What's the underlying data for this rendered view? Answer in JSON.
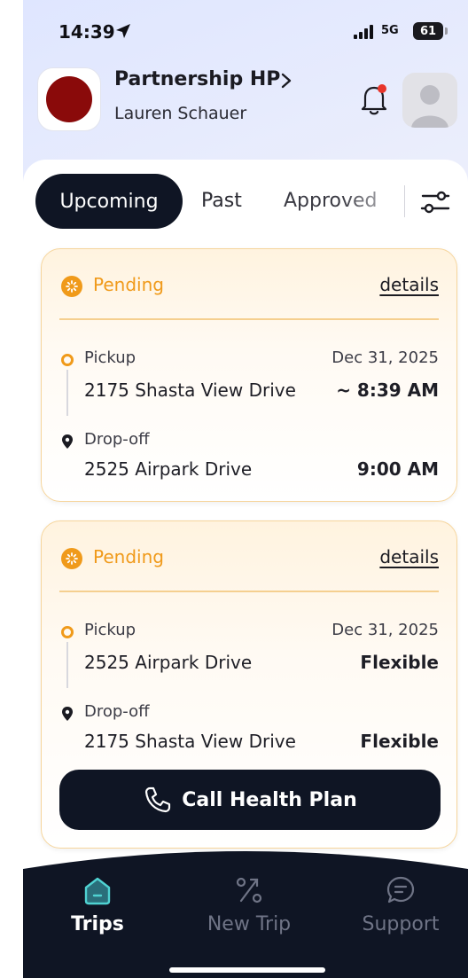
{
  "status_bar": {
    "time": "14:39",
    "network": "5G",
    "battery": "61"
  },
  "header": {
    "org_name": "Partnership HP",
    "user_name": "Lauren Schauer"
  },
  "tabs": {
    "upcoming": "Upcoming",
    "past": "Past",
    "approved": "Approved"
  },
  "trips": [
    {
      "status": "Pending",
      "details_label": "details",
      "pickup_label": "Pickup",
      "pickup_address": "2175 Shasta View Drive",
      "pickup_date": "Dec 31, 2025",
      "pickup_time": "~ 8:39 AM",
      "dropoff_label": "Drop-off",
      "dropoff_address": "2525 Airpark Drive",
      "dropoff_time": "9:00 AM"
    },
    {
      "status": "Pending",
      "details_label": "details",
      "pickup_label": "Pickup",
      "pickup_address": "2525 Airpark Drive",
      "pickup_date": "Dec 31, 2025",
      "pickup_time": "Flexible",
      "dropoff_label": "Drop-off",
      "dropoff_address": "2175 Shasta View Drive",
      "dropoff_time": "Flexible"
    }
  ],
  "call_button": "Call Health Plan",
  "bottom_nav": {
    "trips": "Trips",
    "new_trip": "New Trip",
    "support": "Support"
  },
  "colors": {
    "accent_dark": "#0f1524",
    "pending": "#f09a1a",
    "nav_active": "#4fd2d2",
    "logo": "#8a0a0a"
  },
  "icons": [
    "location-arrow-icon",
    "signal-icon",
    "battery-icon",
    "chevron-right-icon",
    "bell-icon",
    "avatar-icon",
    "filter-icon",
    "pending-icon",
    "pickup-ring-icon",
    "pin-icon",
    "phone-icon",
    "home-icon",
    "route-icon",
    "chat-icon"
  ]
}
